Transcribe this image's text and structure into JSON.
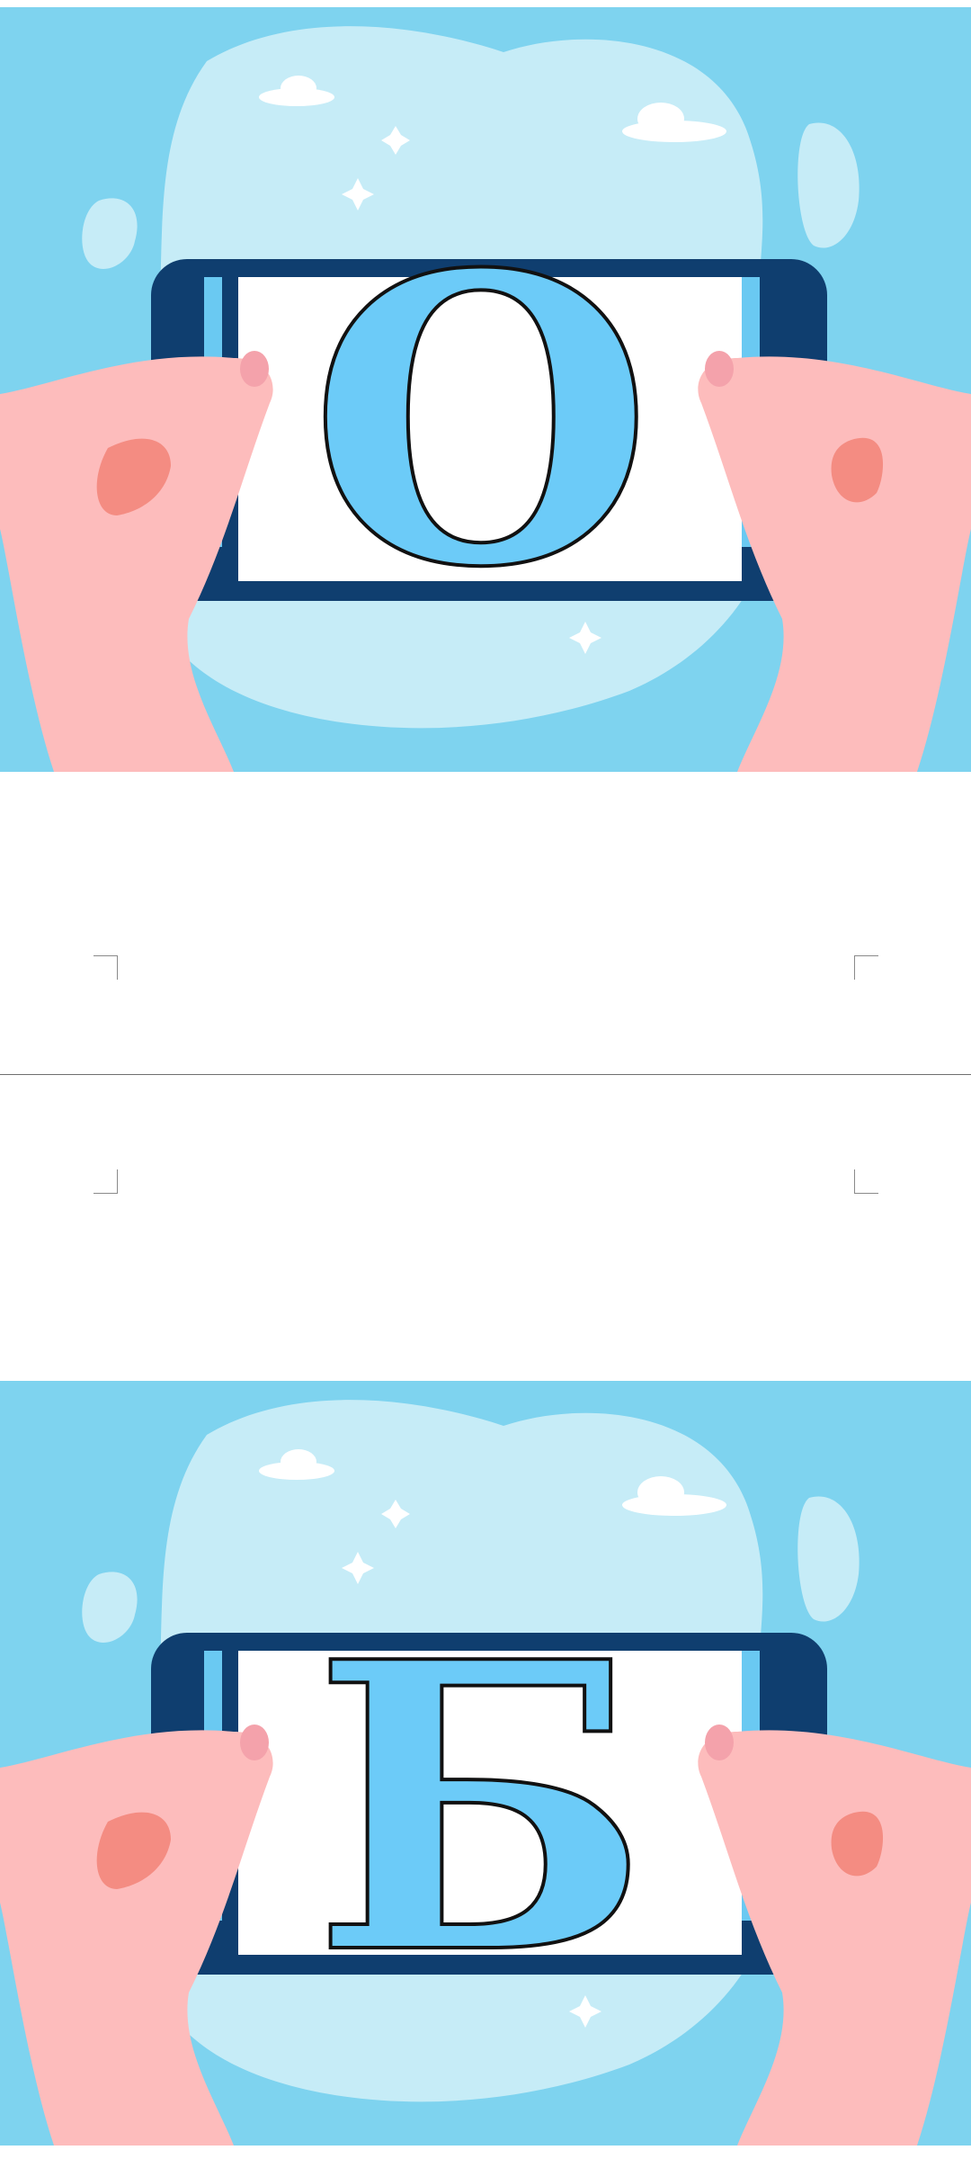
{
  "cards": {
    "top": {
      "letter": "О"
    },
    "bottom": {
      "letter": "Б"
    }
  },
  "colors": {
    "sky": "#7ed3ef",
    "cloud_blob": "#c6ecf7",
    "phone_frame": "#0f3e6f",
    "phone_edge": "#6ac9f2",
    "screen": "#ffffff",
    "skin": "#fdbcbc",
    "skin_shadow": "#f48c82",
    "nail": "#f4a2ab",
    "letter_fill": "#6ccbf8",
    "letter_stroke": "#111111"
  },
  "icons": [
    "cloud-icon",
    "sparkle-icon",
    "hands-icon",
    "smartphone-icon"
  ]
}
